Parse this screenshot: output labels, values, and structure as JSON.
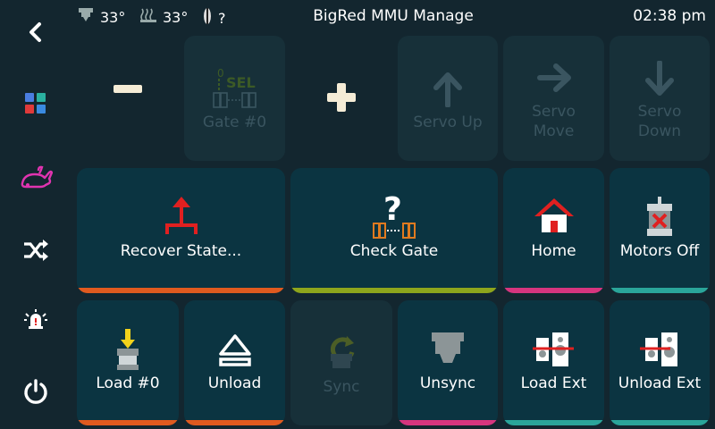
{
  "status": {
    "extruder_temp": "33°",
    "bed_temp": "33°",
    "filament_state": "?",
    "title": "BigRed MMU Manage",
    "time": "02:38 pm"
  },
  "sidebar": {
    "items": [
      {
        "icon": "back-arrow-icon"
      },
      {
        "icon": "grid-icon"
      },
      {
        "icon": "rabbit-icon"
      },
      {
        "icon": "shuffle-icon"
      },
      {
        "icon": "alarm-icon"
      },
      {
        "icon": "power-icon"
      }
    ]
  },
  "row1": {
    "minus": "−",
    "gate": "Gate #0",
    "gate_icon_num": "0",
    "gate_icon_sel": "SEL",
    "plus": "+",
    "servo_up": "Servo Up",
    "servo_move": "Servo Move",
    "servo_down": "Servo Down"
  },
  "row2": {
    "recover": "Recover State...",
    "check_gate": "Check Gate",
    "check_icon": "?",
    "home": "Home",
    "motors_off": "Motors Off"
  },
  "row3": {
    "load": "Load #0",
    "unload": "Unload",
    "sync": "Sync",
    "unsync": "Unsync",
    "load_ext": "Load Ext",
    "unload_ext": "Unload Ext"
  },
  "colors": {
    "background": "#13262f",
    "tile": "#0b3441",
    "orange": "#e05a1f",
    "olive": "#8ea51c",
    "magenta": "#d6357e",
    "teal": "#2aa59a",
    "red": "#e02020",
    "yellow": "#f2d21b"
  }
}
